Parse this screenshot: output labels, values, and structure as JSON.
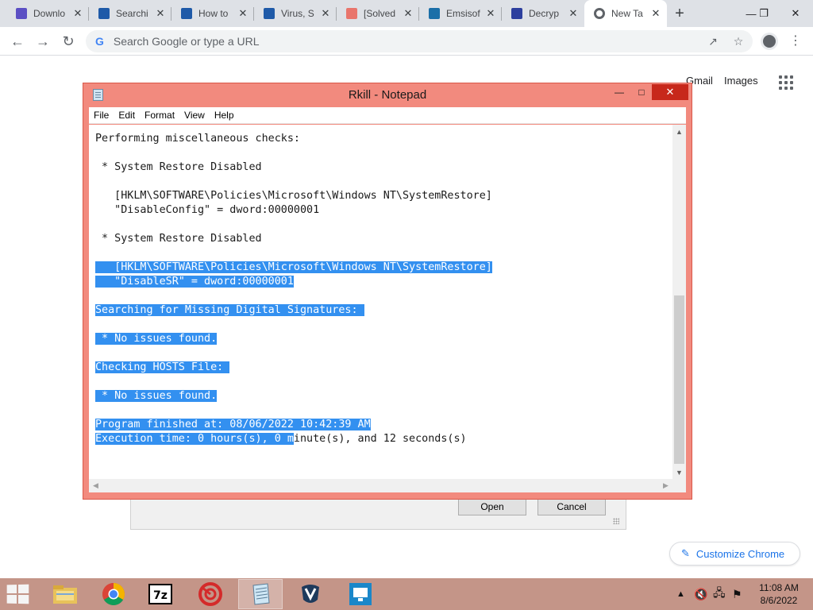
{
  "browser": {
    "tabs": [
      {
        "title": "Downlo",
        "favicon_color": "#5b4fc4",
        "active": false
      },
      {
        "title": "Searchi",
        "favicon_color": "#1f5aa8",
        "active": false
      },
      {
        "title": "How to",
        "favicon_color": "#1f5aa8",
        "active": false
      },
      {
        "title": "Virus, S",
        "favicon_color": "#1f5aa8",
        "active": false
      },
      {
        "title": "[Solved",
        "favicon_color": "#e9756c",
        "active": false
      },
      {
        "title": "Emsisof",
        "favicon_color": "#1b6fa8",
        "active": false
      },
      {
        "title": "Decryp",
        "favicon_color": "#2d3f9e",
        "active": false
      },
      {
        "title": "New Ta",
        "favicon_color": "#5f6368",
        "active": true
      }
    ],
    "omnibox": {
      "placeholder": "Search Google or type a URL",
      "value": ""
    },
    "ntp": {
      "gmail": "Gmail",
      "images": "Images",
      "customize": "Customize Chrome"
    }
  },
  "file_dialog": {
    "open_label": "Open",
    "cancel_label": "Cancel"
  },
  "notepad": {
    "title": "Rkill - Notepad",
    "menu": [
      "File",
      "Edit",
      "Format",
      "View",
      "Help"
    ],
    "lines": [
      {
        "text": "Performing miscellaneous checks:",
        "selected": false
      },
      {
        "text": "",
        "selected": false
      },
      {
        "text": " * System Restore Disabled",
        "selected": false
      },
      {
        "text": "",
        "selected": false
      },
      {
        "text": "   [HKLM\\SOFTWARE\\Policies\\Microsoft\\Windows NT\\SystemRestore]",
        "selected": false
      },
      {
        "text": "   \"DisableConfig\" = dword:00000001",
        "selected": false
      },
      {
        "text": "",
        "selected": false
      },
      {
        "text": " * System Restore Disabled",
        "selected": false
      },
      {
        "text": "",
        "selected": false
      },
      {
        "text": "   [HKLM\\SOFTWARE\\Policies\\Microsoft\\Windows NT\\SystemRestore]",
        "selected": true
      },
      {
        "text": "   \"DisableSR\" = dword:00000001",
        "selected": true
      },
      {
        "text": "",
        "selected": false
      },
      {
        "text": "Searching for Missing Digital Signatures: ",
        "selected": true
      },
      {
        "text": "",
        "selected": false
      },
      {
        "text": " * No issues found.",
        "selected": true
      },
      {
        "text": "",
        "selected": false
      },
      {
        "text": "Checking HOSTS File: ",
        "selected": true
      },
      {
        "text": "",
        "selected": false
      },
      {
        "text": " * No issues found.",
        "selected": true
      },
      {
        "text": "",
        "selected": false
      },
      {
        "text": "Program finished at: 08/06/2022 10:42:39 AM",
        "selected": true
      },
      {
        "text": "Execution time: 0 hours(s), 0 minute(s), and 12 seconds(s)",
        "selected": "partial",
        "selected_prefix": "Execution time: 0 hours(s), 0 m",
        "rest": "inute(s), and 12 seconds(s)"
      }
    ]
  },
  "taskbar": {
    "apps": [
      "File Explorer",
      "Google Chrome",
      "7-Zip",
      "RKill",
      "Notepad",
      "Malwarebytes",
      "Remote Desktop"
    ],
    "clock_time": "11:08 AM",
    "clock_date": "8/6/2022"
  },
  "colors": {
    "notepad_frame": "#f28a7e",
    "selection": "#3390f0",
    "taskbar": "#c49588",
    "close_button": "#c7281b"
  }
}
